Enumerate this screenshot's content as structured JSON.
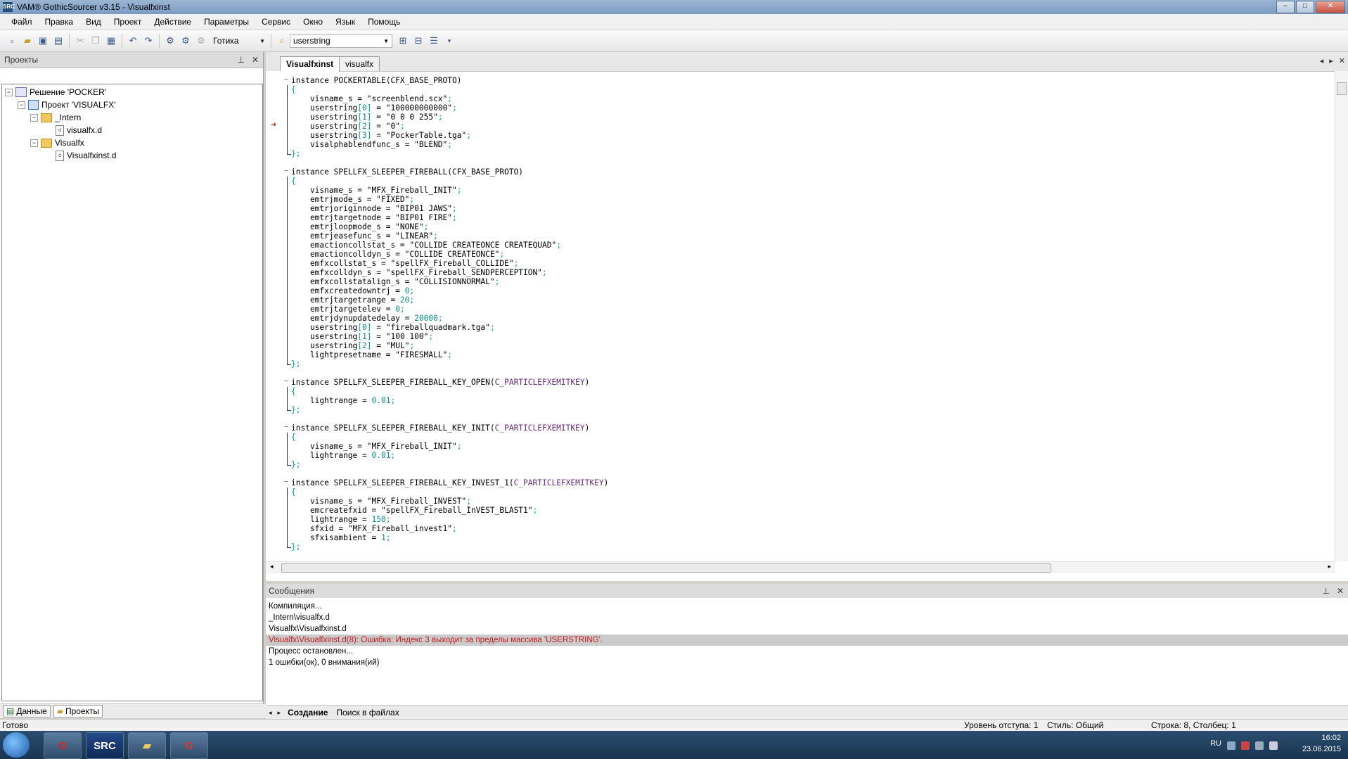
{
  "window": {
    "title": "VAM® GothicSourcer v3.15 - Visualfxinst"
  },
  "menu": [
    "Файл",
    "Правка",
    "Вид",
    "Проект",
    "Действие",
    "Параметры",
    "Сервис",
    "Окно",
    "Язык",
    "Помощь"
  ],
  "toolbar": {
    "language_combo": "Готика",
    "search_combo": "userstring"
  },
  "left_panel": {
    "title": "Проекты",
    "tree": [
      {
        "label": "Решение 'POCKER'",
        "icon": "solution-icon"
      },
      {
        "label": "Проект 'VISUALFX'",
        "icon": "project-icon"
      },
      {
        "label": "_Intern",
        "icon": "folder-icon"
      },
      {
        "label": "visualfx.d",
        "icon": "file-icon"
      },
      {
        "label": "Visualfx",
        "icon": "folder-icon"
      },
      {
        "label": "Visualfxinst.d",
        "icon": "file-icon"
      }
    ],
    "bottom_tabs": [
      "Данные",
      "Проекты"
    ]
  },
  "editor": {
    "tabs": [
      "Visualfxinst",
      "visualfx"
    ],
    "code_lines": [
      "instance POCKERTABLE(CFX_BASE_PROTO)",
      "{",
      "    visname_s = \"screenblend.scx\";",
      "    userstring[0] = \"100000000000\";",
      "    userstring[1] = \"0 0 0 255\";",
      "    userstring[2] = \"0\";",
      "    userstring[3] = \"PockerTable.tga\";",
      "    visalphablendfunc_s = \"BLEND\";",
      "};",
      "",
      "instance SPELLFX_SLEEPER_FIREBALL(CFX_BASE_PROTO)",
      "{",
      "    visname_s = \"MFX_Fireball_INIT\";",
      "    emtrjmode_s = \"FIXED\";",
      "    emtrjoriginnode = \"BIP01 JAWS\";",
      "    emtrjtargetnode = \"BIP01 FIRE\";",
      "    emtrjloopmode_s = \"NONE\";",
      "    emtrjeasefunc_s = \"LINEAR\";",
      "    emactioncollstat_s = \"COLLIDE CREATEONCE CREATEQUAD\";",
      "    emactioncolldyn_s = \"COLLIDE CREATEONCE\";",
      "    emfxcollstat_s = \"spellFX_Fireball_COLLIDE\";",
      "    emfxcolldyn_s = \"spellFX_Fireball_SENDPERCEPTION\";",
      "    emfxcollstatalign_s = \"COLLISIONNORMAL\";",
      "    emfxcreatedowntrj = 0;",
      "    emtrjtargetrange = 20;",
      "    emtrjtargetelev = 0;",
      "    emtrjdynupdatedelay = 20000;",
      "    userstring[0] = \"fireballquadmark.tga\";",
      "    userstring[1] = \"100 100\";",
      "    userstring[2] = \"MUL\";",
      "    lightpresetname = \"FIRESMALL\";",
      "};",
      "",
      "instance SPELLFX_SLEEPER_FIREBALL_KEY_OPEN(C_PARTICLEFXEMITKEY)",
      "{",
      "    lightrange = 0.01;",
      "};",
      "",
      "instance SPELLFX_SLEEPER_FIREBALL_KEY_INIT(C_PARTICLEFXEMITKEY)",
      "{",
      "    visname_s = \"MFX_Fireball_INIT\";",
      "    lightrange = 0.01;",
      "};",
      "",
      "instance SPELLFX_SLEEPER_FIREBALL_KEY_INVEST_1(C_PARTICLEFXEMITKEY)",
      "{",
      "    visname_s = \"MFX_Fireball_INVEST\";",
      "    emcreatefxid = \"spellFX_Fireball_InVEST_BLAST1\";",
      "    lightrange = 150;",
      "    sfxid = \"MFX_Fireball_invest1\";",
      "    sfxisambient = 1;",
      "};"
    ]
  },
  "messages": {
    "title": "Сообщения",
    "lines": [
      "Компиляция...",
      "_Intern\\visualfx.d",
      "Visualfx\\Visualfxinst.d",
      "Visualfx\\Visualfxinst.d(8):   Ошибка: Индекс 3 выходит за пределы массива 'USERSTRING'.",
      "Процесс остановлен...",
      "1 ошибки(ок), 0 внимания(ий)"
    ],
    "tabs": [
      "Создание",
      "Поиск в файлах"
    ]
  },
  "status": {
    "left": "Готово",
    "indent": "Уровень отступа: 1",
    "style": "Стиль: Общий",
    "position": "Строка: 8, Столбец: 1"
  },
  "taskbar": {
    "lang": "RU",
    "time": "16:02",
    "date": "23.06.2015",
    "apps": [
      "opera-icon",
      "gothicsourcer-icon",
      "explorer-icon",
      "g-app-icon"
    ]
  }
}
